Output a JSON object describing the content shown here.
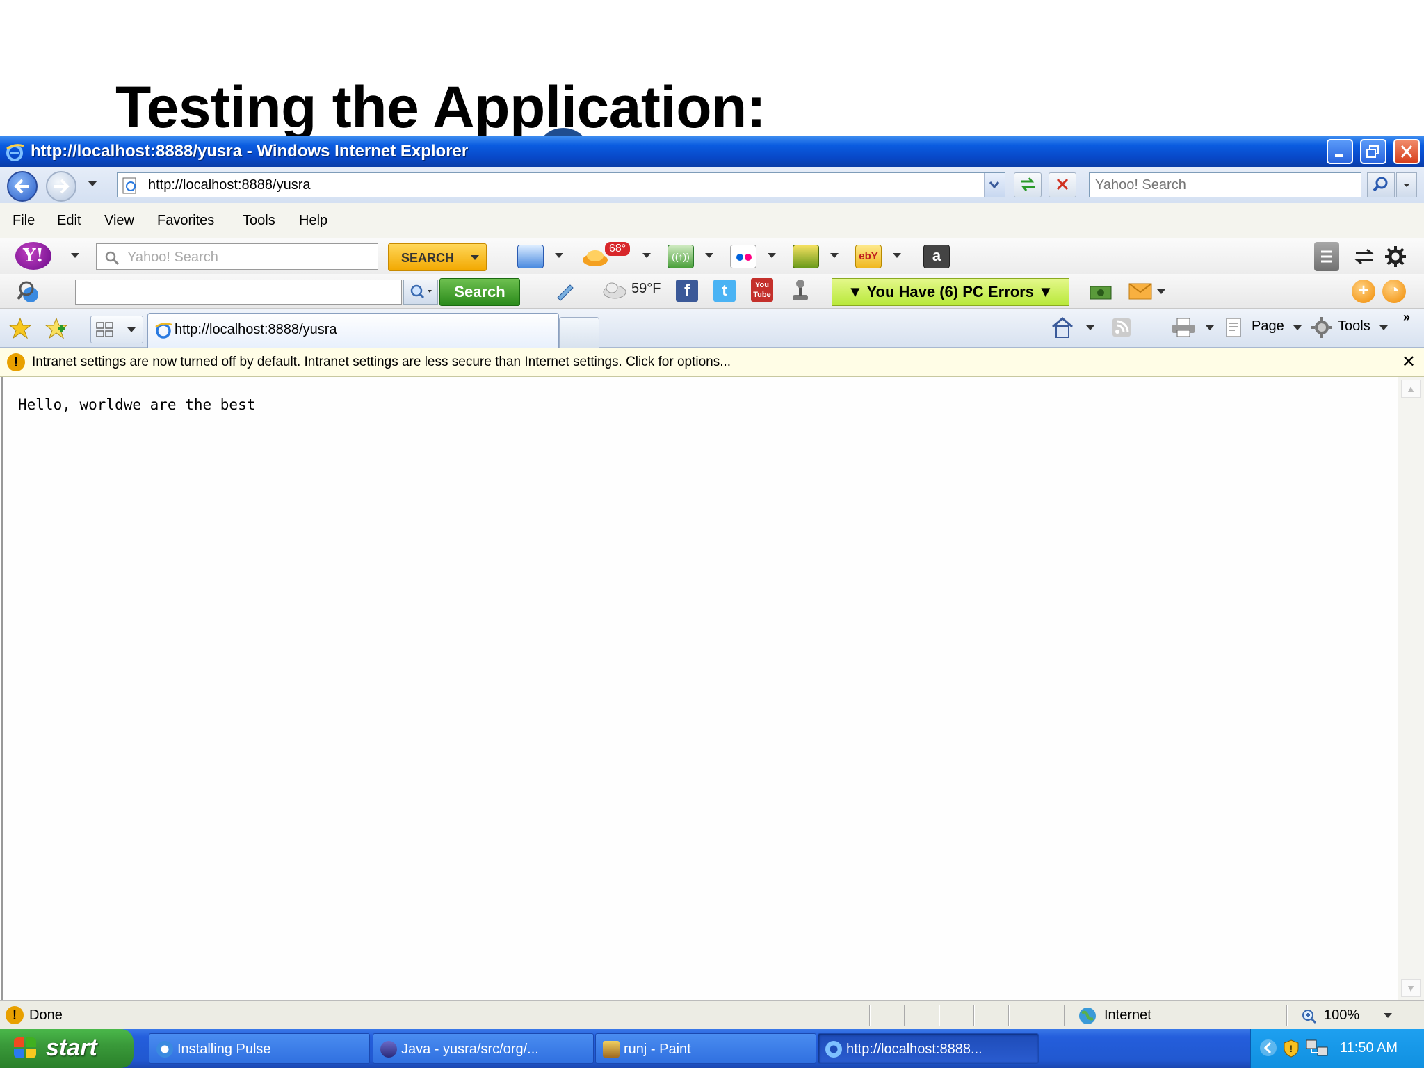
{
  "slide": {
    "title": "Testing the Application:"
  },
  "window": {
    "title": "http://localhost:8888/yusra - Windows Internet Explorer",
    "address": "http://localhost:8888/yusra",
    "search_placeholder": "Yahoo! Search"
  },
  "menu": [
    "File",
    "Edit",
    "View",
    "Favorites",
    "Tools",
    "Help"
  ],
  "yahoo_toolbar": {
    "logo": "Y!",
    "search_placeholder": "Yahoo! Search",
    "search_button": "SEARCH",
    "weather_badge": "68°",
    "ebay_label": "ebY",
    "amazon_label": "a"
  },
  "second_toolbar": {
    "search_button": "Search",
    "weather": "59°F",
    "facebook": "f",
    "twitter": "t",
    "youtube": "You Tube",
    "pc_errors": "▼ You Have (6) PC Errors ▼"
  },
  "tab": {
    "label": "http://localhost:8888/yusra"
  },
  "commands": {
    "page": "Page",
    "tools": "Tools"
  },
  "infobar": {
    "message": "Intranet settings are now turned off by default. Intranet settings are less secure than Internet settings. Click for options..."
  },
  "content": {
    "text": "Hello, worldwe are the best"
  },
  "status": {
    "left": "Done",
    "zone": "Internet",
    "zoom": "100%"
  },
  "taskbar": {
    "start": "start",
    "tasks": [
      {
        "label": "Installing Pulse"
      },
      {
        "label": "Java - yusra/src/org/..."
      },
      {
        "label": "runj - Paint"
      },
      {
        "label": "http://localhost:8888..."
      }
    ],
    "clock": "11:50 AM"
  },
  "colors": {
    "titlebar": "#0848c8",
    "taskbar": "#245edc",
    "start": "#3a9a3a",
    "pc_errors_bg": "#c8ee50",
    "infobar_bg": "#fffde6"
  }
}
